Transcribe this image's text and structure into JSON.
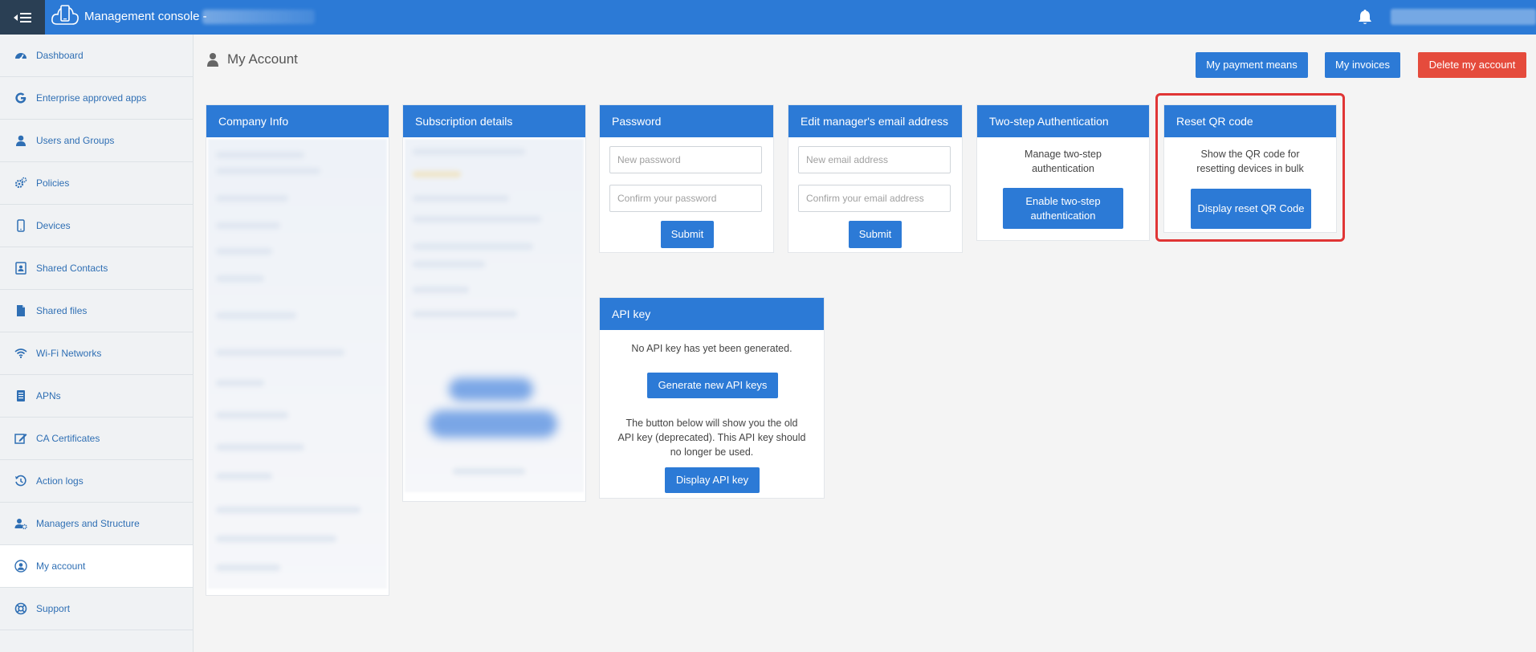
{
  "topbar": {
    "title": "Management console -",
    "menu_icon": "menu-collapse-icon",
    "logo_icon": "cloud-phone-icon",
    "notification_icon": "bell-icon"
  },
  "sidebar": {
    "items": [
      {
        "label": "Dashboard",
        "icon": "dashboard-icon"
      },
      {
        "label": "Enterprise approved apps",
        "icon": "google-icon"
      },
      {
        "label": "Users and Groups",
        "icon": "user-icon"
      },
      {
        "label": "Policies",
        "icon": "gears-icon"
      },
      {
        "label": "Devices",
        "icon": "mobile-icon"
      },
      {
        "label": "Shared Contacts",
        "icon": "contact-card-icon"
      },
      {
        "label": "Shared files",
        "icon": "file-icon"
      },
      {
        "label": "Wi-Fi Networks",
        "icon": "wifi-icon"
      },
      {
        "label": "APNs",
        "icon": "document-list-icon"
      },
      {
        "label": "CA Certificates",
        "icon": "certificate-edit-icon"
      },
      {
        "label": "Action logs",
        "icon": "history-icon"
      },
      {
        "label": "Managers and Structure",
        "icon": "user-gear-icon"
      },
      {
        "label": "My account",
        "icon": "user-circle-icon"
      },
      {
        "label": "Support",
        "icon": "lifebuoy-icon"
      }
    ],
    "active": "My account"
  },
  "page": {
    "title": "My Account",
    "title_icon": "user-icon",
    "buttons": {
      "payment": "My payment means",
      "invoices": "My invoices",
      "delete": "Delete my account"
    }
  },
  "panels": {
    "company": {
      "title": "Company Info"
    },
    "subscription": {
      "title": "Subscription details"
    },
    "password": {
      "title": "Password",
      "new_placeholder": "New password",
      "confirm_placeholder": "Confirm your password",
      "submit": "Submit"
    },
    "email": {
      "title": "Edit manager's email address",
      "new_placeholder": "New email address",
      "confirm_placeholder": "Confirm your email address",
      "submit": "Submit"
    },
    "two_step": {
      "title": "Two-step Authentication",
      "text": "Manage two-step authentication",
      "button": "Enable two-step authentication"
    },
    "reset_qr": {
      "title": "Reset QR code",
      "text": "Show the QR code for resetting devices in bulk",
      "button": "Display reset QR Code"
    },
    "api_key": {
      "title": "API key",
      "status": "No API key has yet been generated.",
      "generate": "Generate new API keys",
      "note": "The button below will show you the old API key (deprecated). This API key should no longer be used.",
      "display": "Display API key"
    }
  },
  "colors": {
    "primary": "#2c7ad6",
    "danger": "#e54b3c",
    "sidebar_dark": "#2a3f54",
    "highlight": "#e03535",
    "link": "#2f6fb4"
  }
}
